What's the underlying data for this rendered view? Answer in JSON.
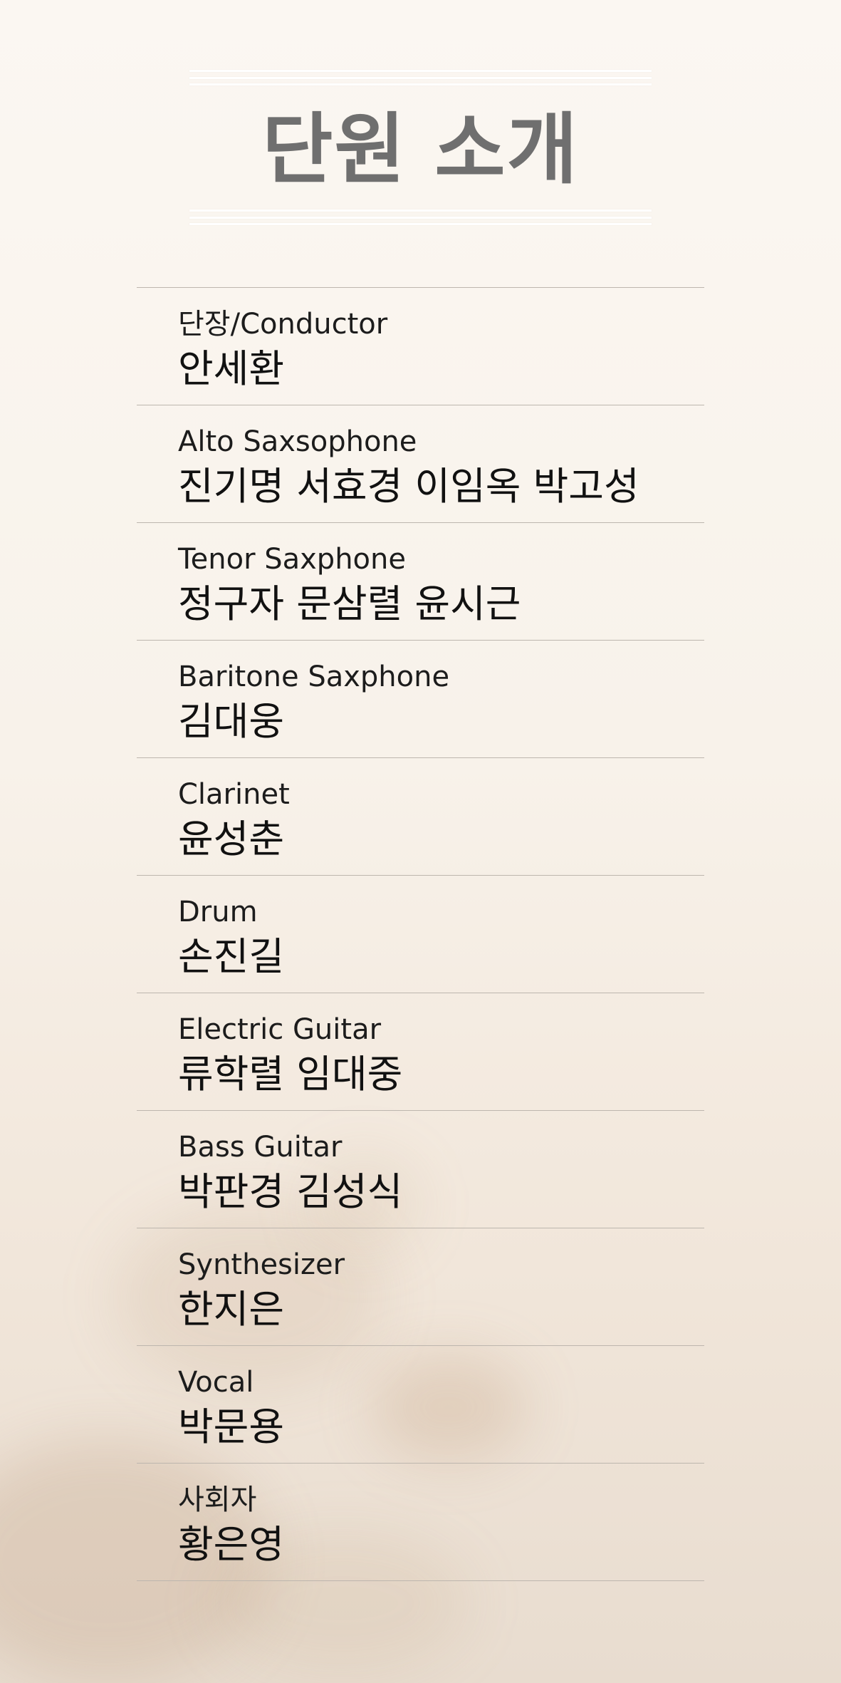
{
  "title": "단원 소개",
  "members": [
    {
      "role": "단장/Conductor",
      "names": "안세환"
    },
    {
      "role": "Alto Saxsophone",
      "names": "진기명 서효경 이임옥 박고성"
    },
    {
      "role": "Tenor Saxphone",
      "names": "정구자 문삼렬 윤시근"
    },
    {
      "role": "Baritone Saxphone",
      "names": "김대웅"
    },
    {
      "role": "Clarinet",
      "names": "윤성춘"
    },
    {
      "role": "Drum",
      "names": "손진길"
    },
    {
      "role": "Electric Guitar",
      "names": "류학렬 임대중"
    },
    {
      "role": "Bass Guitar",
      "names": "박판경 김성식"
    },
    {
      "role": "Synthesizer",
      "names": "한지은"
    },
    {
      "role": "Vocal",
      "names": "박문용"
    },
    {
      "role": "사회자",
      "names": "황은영"
    }
  ],
  "colors": {
    "background": "#f8f2ea",
    "title": "#6f6f6f",
    "divider": "#bdb6ae",
    "text": "#111111"
  }
}
